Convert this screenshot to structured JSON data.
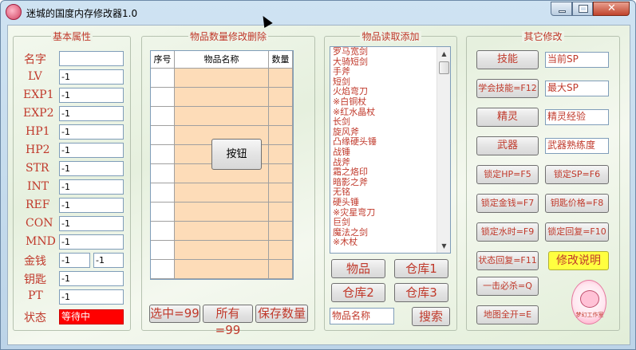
{
  "window": {
    "title": "迷城的国度内存修改器1.0"
  },
  "groups": {
    "basic": "基本属性",
    "items": "物品数量修改删除",
    "read": "物品读取添加",
    "other": "其它修改"
  },
  "attributes": [
    {
      "label": "名字",
      "value": ""
    },
    {
      "label": "LV",
      "value": "-1"
    },
    {
      "label": "EXP1",
      "value": "-1"
    },
    {
      "label": "EXP2",
      "value": "-1"
    },
    {
      "label": "HP1",
      "value": "-1"
    },
    {
      "label": "HP2",
      "value": "-1"
    },
    {
      "label": "STR",
      "value": "-1"
    },
    {
      "label": "INT",
      "value": "-1"
    },
    {
      "label": "REF",
      "value": "-1"
    },
    {
      "label": "CON",
      "value": "-1"
    },
    {
      "label": "MND",
      "value": "-1"
    },
    {
      "label": "金钱",
      "value": "-1",
      "value2": "-1"
    },
    {
      "label": "钥匙",
      "value": "-1"
    },
    {
      "label": "PT",
      "value": "-1"
    },
    {
      "label": "状态",
      "value": "等待中"
    }
  ],
  "grid": {
    "headers": [
      "序号",
      "物品名称",
      "数量"
    ],
    "center_button": "按钮",
    "row_count": 12
  },
  "item_buttons": {
    "select99": "选中=99",
    "all99": "所有=99",
    "save": "保存数量"
  },
  "item_list": [
    "罗马宽剑",
    "大骑短剑",
    "手斧",
    "短剑",
    "火焰弯刀",
    "※白铜杖",
    "※红水晶杖",
    "长剑",
    "旋风斧",
    "凸缘硬头锤",
    "战锤",
    "战斧",
    "霜之烙印",
    "暗影之斧",
    "无铭",
    "硬头锤",
    "※灾星弯刀",
    "巨剑",
    "魔法之剑",
    "※木杖"
  ],
  "read_buttons": {
    "items": "物品",
    "store1": "仓库1",
    "store2": "仓库2",
    "store3": "仓库3",
    "search_placeholder": "物品名称",
    "search": "搜索"
  },
  "other": {
    "skill": "技能",
    "current_sp": "当前SP",
    "learn_skill": "学会技能=F12",
    "max_sp": "最大SP",
    "spirit": "精灵",
    "spirit_exp": "精灵经验",
    "weapon": "武器",
    "weapon_skill": "武器熟练度",
    "lock_hp": "锁定HP=F5",
    "lock_sp": "锁定SP=F6",
    "lock_money": "锁定金钱=F7",
    "key_price": "钥匙价格=F8",
    "lock_water": "锁定水时=F9",
    "lock_restore": "锁定回复=F10",
    "status_restore": "状态回复=F11",
    "mod_desc": "修改说明",
    "one_hit": "一击必杀=Q",
    "map_open": "地图全开=E"
  },
  "logo": {
    "text": "梦幻工作室"
  }
}
